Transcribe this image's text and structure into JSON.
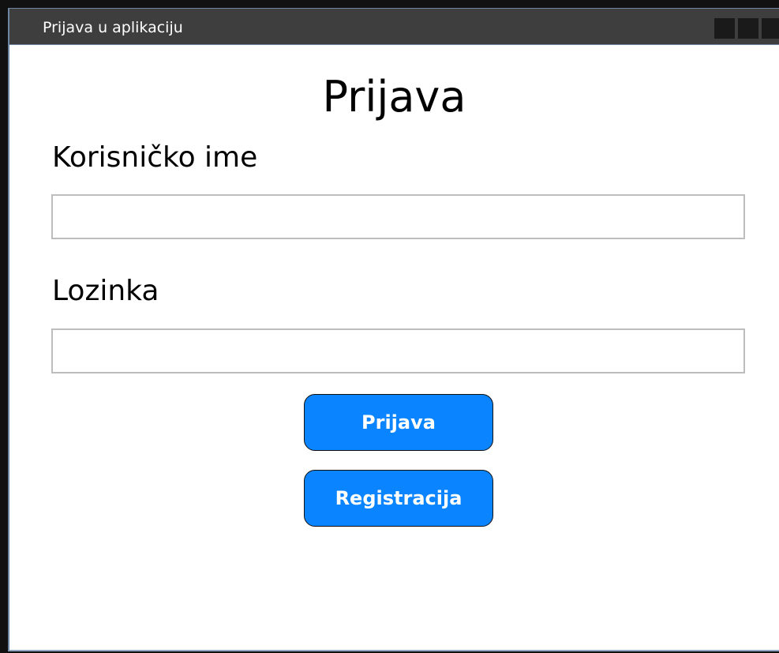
{
  "window": {
    "title": "Prijava u aplikaciju"
  },
  "form": {
    "heading": "Prijava",
    "username_label": "Korisničko ime",
    "username_value": "",
    "password_label": "Lozinka",
    "password_value": "",
    "login_button": "Prijava",
    "register_button": "Registracija"
  },
  "colors": {
    "titlebar": "#3e3e3e",
    "button": "#0a84ff",
    "input_border": "#bdbdbd"
  }
}
